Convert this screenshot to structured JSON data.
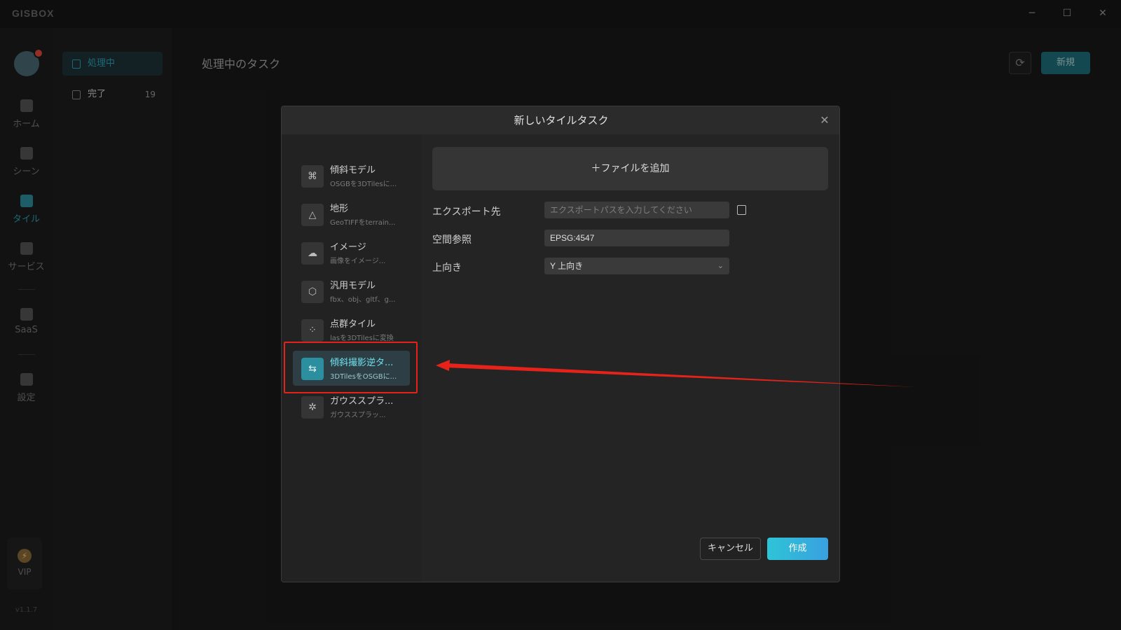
{
  "app": {
    "logo": "GISBOX"
  },
  "window_controls": {
    "minimize": "─",
    "maximize": "☐",
    "close": "✕"
  },
  "leftnav": {
    "items": [
      {
        "label": "ホーム"
      },
      {
        "label": "シーン"
      },
      {
        "label": "タイル"
      },
      {
        "label": "サービス"
      },
      {
        "label": "SaaS"
      },
      {
        "label": "設定"
      }
    ],
    "vip": "VIP",
    "version": "v1.1.7"
  },
  "subnav": {
    "items": [
      {
        "label": "処理中"
      },
      {
        "label": "完了",
        "count": "19"
      }
    ]
  },
  "main": {
    "title": "処理中のタスク",
    "new_button": "新規"
  },
  "modal": {
    "title": "新しいタイルタスク",
    "types": [
      {
        "name": "傾斜モデル",
        "desc": "OSGBを3DTilesに..."
      },
      {
        "name": "地形",
        "desc": "GeoTIFFをterrain..."
      },
      {
        "name": "イメージ",
        "desc": "画像をイメージ..."
      },
      {
        "name": "汎用モデル",
        "desc": "fbx、obj、gltf、g..."
      },
      {
        "name": "点群タイル",
        "desc": "lasを3DTilesに変換"
      },
      {
        "name": "傾斜撮影逆タ...",
        "desc": "3DTilesをOSGBに..."
      },
      {
        "name": "ガウススプラ...",
        "desc": "ガウススプラッ..."
      }
    ],
    "add_file": "＋ファイルを追加",
    "fields": {
      "export_label": "エクスポート先",
      "export_placeholder": "エクスポートパスを入力してください",
      "crs_label": "空間参照",
      "crs_value": "EPSG:4547",
      "up_label": "上向き",
      "up_value": "Y 上向き"
    },
    "cancel": "キャンセル",
    "create": "作成"
  },
  "colors": {
    "accent": "#2ba3b8",
    "highlight": "#e5231a"
  }
}
